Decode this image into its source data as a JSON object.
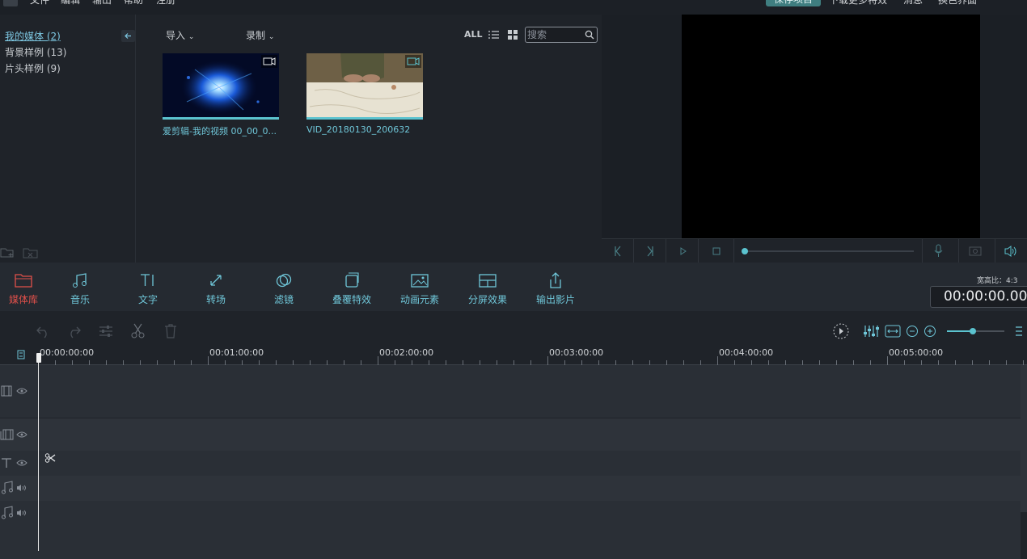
{
  "menu": {
    "items": [
      "文件",
      "编辑",
      "输出",
      "帮助",
      "注册"
    ],
    "save_project": "保存项目",
    "download_effects": "下载更多特效",
    "messages": "消息",
    "skin": "换色界面"
  },
  "library": {
    "categories": [
      {
        "label": "我的媒体 (2)"
      },
      {
        "label": "背景样例 (13)"
      },
      {
        "label": "片头样例 (9)"
      }
    ],
    "import_label": "导入",
    "record_label": "录制",
    "all_label": "ALL",
    "search_placeholder": "搜索",
    "media": [
      {
        "caption": "爱剪辑-我的视频 00_00_0..."
      },
      {
        "caption": "VID_20180130_200632"
      }
    ]
  },
  "toolbar": {
    "tools": [
      {
        "label": "媒体库",
        "icon": "folder-icon"
      },
      {
        "label": "音乐",
        "icon": "music-note-icon"
      },
      {
        "label": "文字",
        "icon": "text-icon"
      },
      {
        "label": "转场",
        "icon": "transition-icon"
      },
      {
        "label": "滤镜",
        "icon": "filter-icon"
      },
      {
        "label": "叠覆特效",
        "icon": "overlay-icon"
      },
      {
        "label": "动画元素",
        "icon": "image-icon"
      },
      {
        "label": "分屏效果",
        "icon": "split-screen-icon"
      },
      {
        "label": "输出影片",
        "icon": "export-icon"
      }
    ],
    "aspect_label": "宽高比：4:3",
    "timecode": "00:00:00.00"
  },
  "timeline": {
    "ruler_labels": [
      "00:00:00:00",
      "00:01:00:00",
      "00:02:00:00",
      "00:03:00:00",
      "00:04:00:00",
      "00:05:00:00"
    ]
  },
  "colors": {
    "accent": "#5bc3cf",
    "active_tool": "#e0504a",
    "save_button": "#3f7e80"
  }
}
